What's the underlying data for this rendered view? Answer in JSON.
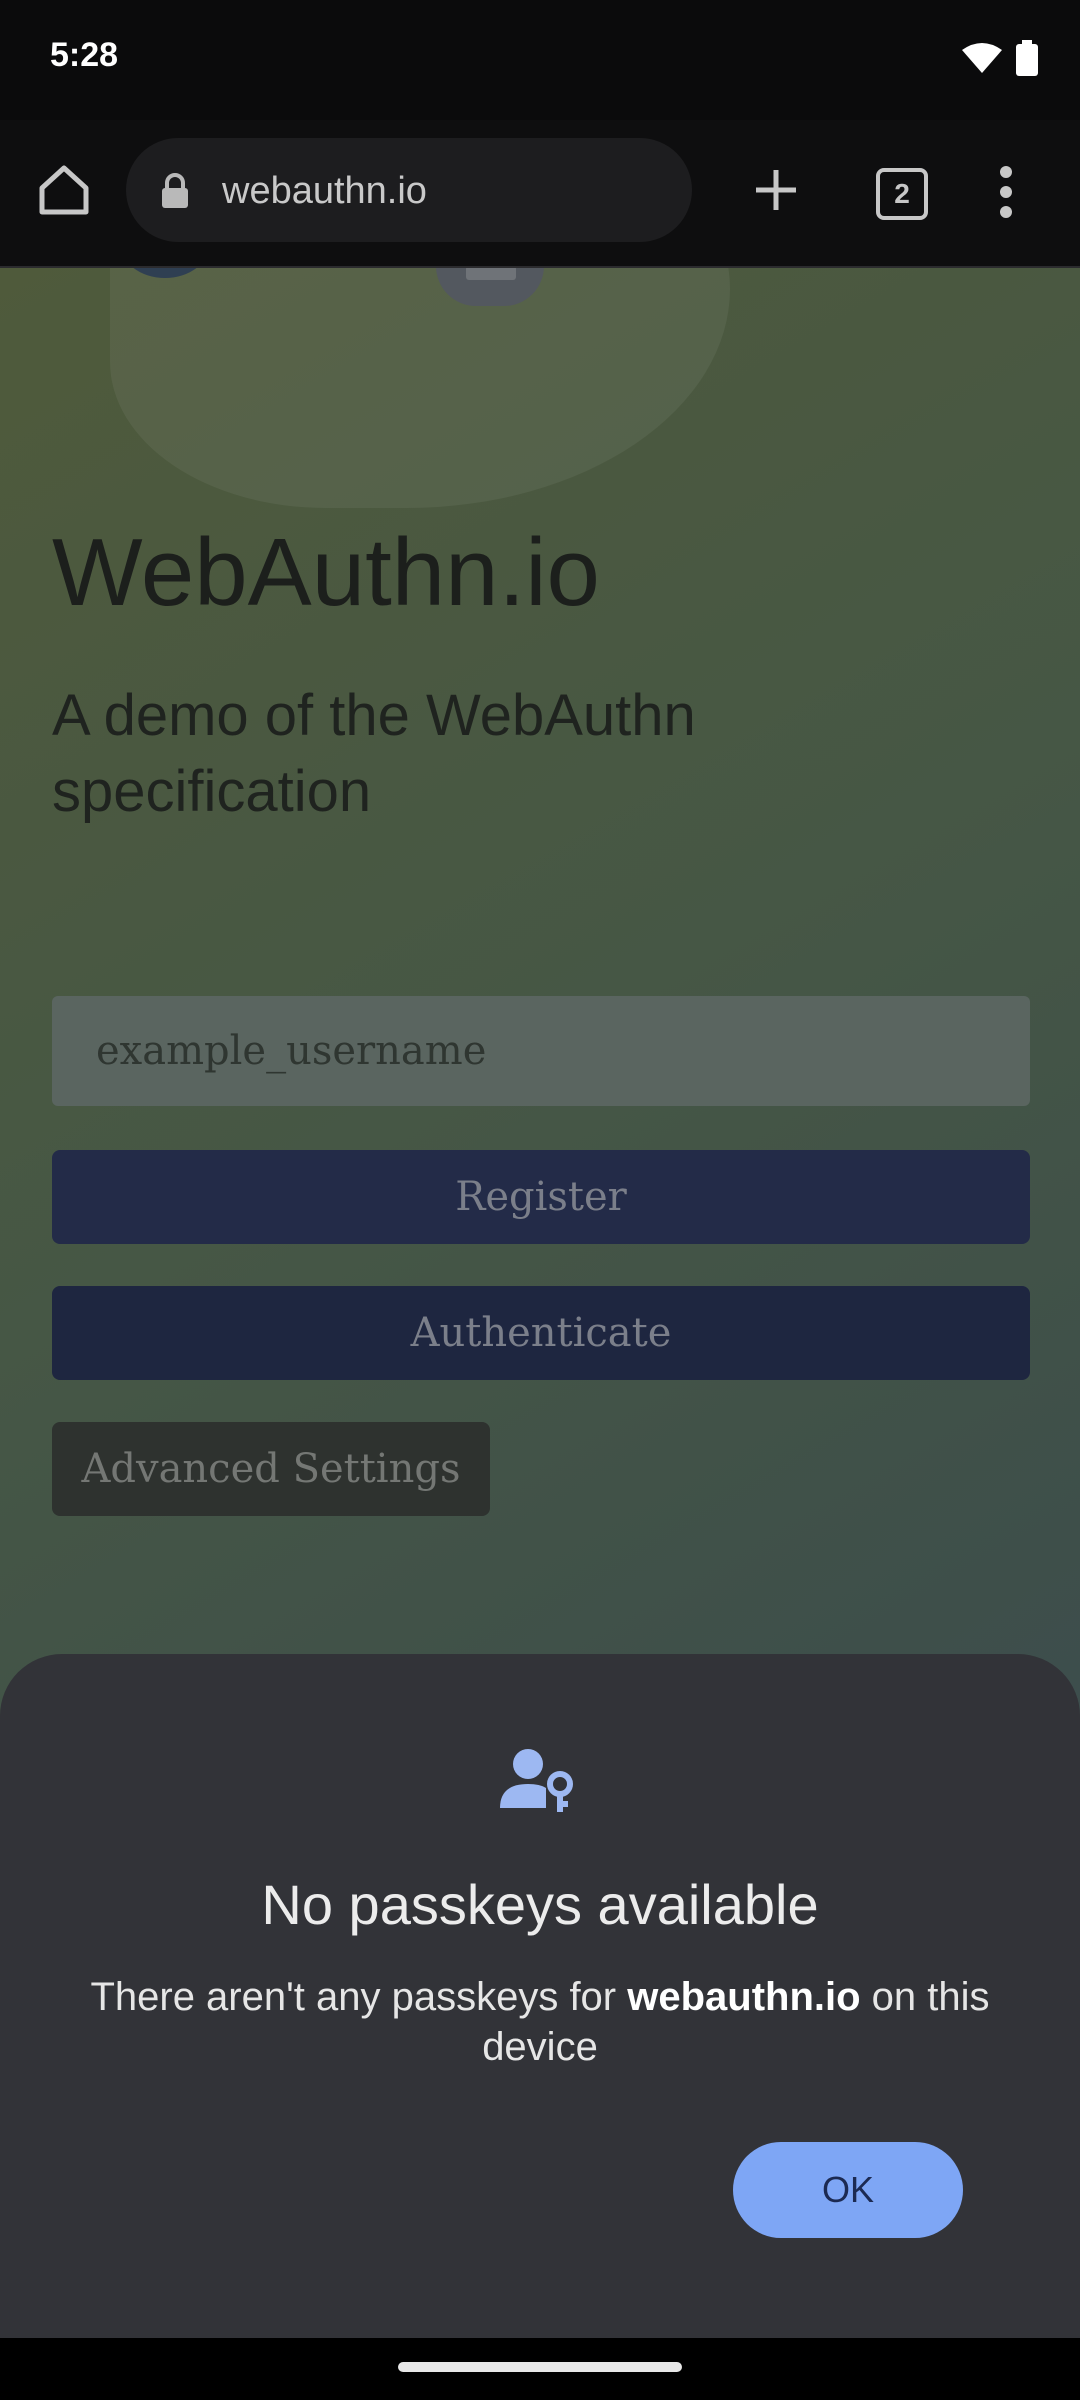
{
  "status_bar": {
    "time": "5:28",
    "icons": [
      "wifi-icon",
      "battery-icon"
    ]
  },
  "browser": {
    "url": "webauthn.io",
    "tab_count": "2",
    "icons": [
      "home-icon",
      "lock-icon",
      "new-tab-icon",
      "tabs-icon",
      "more-menu-icon"
    ]
  },
  "page": {
    "title": "WebAuthn.io",
    "subtitle": "A demo of the WebAuthn specification",
    "username_placeholder": "example_username",
    "register_label": "Register",
    "authenticate_label": "Authenticate",
    "advanced_label": "Advanced Settings"
  },
  "sheet": {
    "icon": "passkey-user-icon",
    "title": "No passkeys available",
    "body_pre": "There aren't any passkeys for ",
    "body_domain": "webauthn.io",
    "body_post": " on this device",
    "ok_label": "OK",
    "accent_color": "#7ea6f5"
  }
}
